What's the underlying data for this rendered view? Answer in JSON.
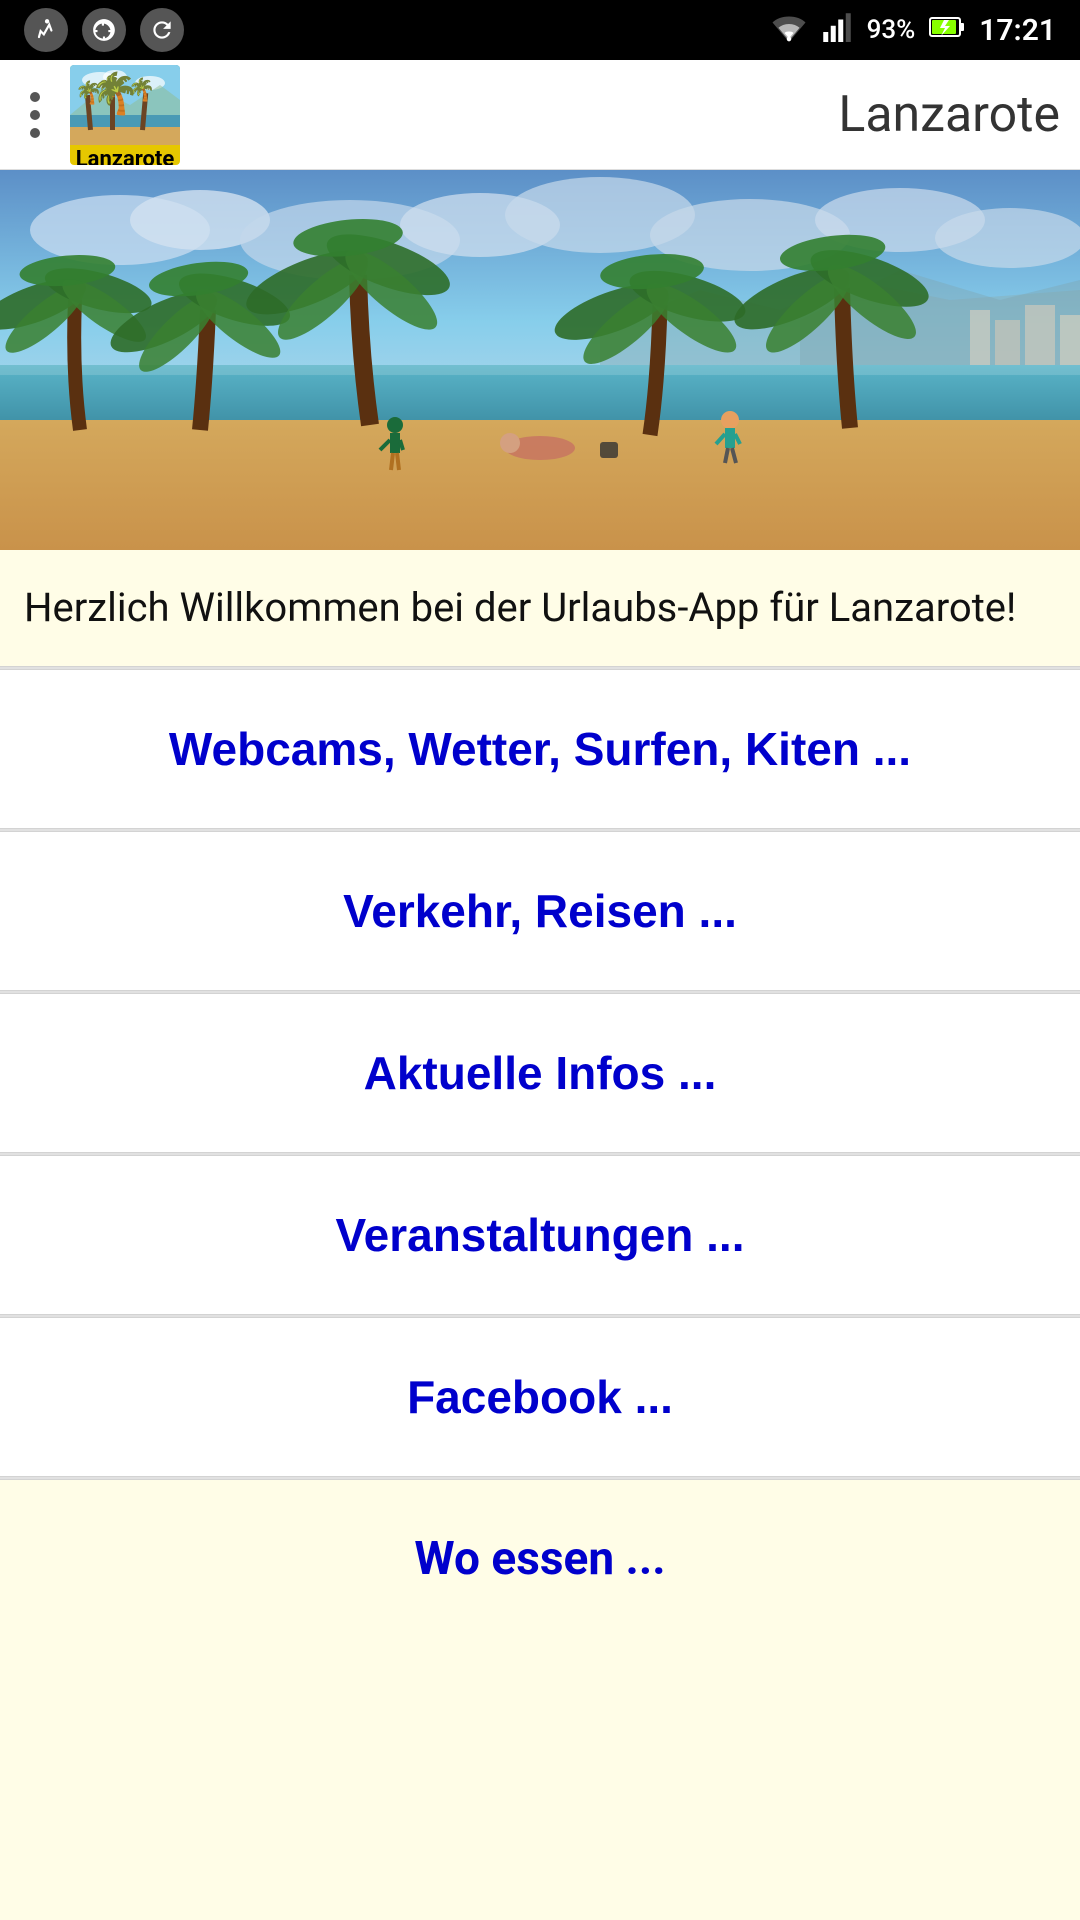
{
  "statusBar": {
    "battery": "93%",
    "time": "17:21",
    "icons": [
      "running-icon",
      "accessibility-icon",
      "refresh-icon"
    ]
  },
  "appBar": {
    "menuLabel": "menu",
    "iconLabel": "Lanzarote",
    "title": "Lanzarote"
  },
  "hero": {
    "altText": "Lanzarote beach with palm trees"
  },
  "welcome": {
    "text": "Herzlich Willkommen bei der Urlaubs-App für Lanzarote!"
  },
  "menuItems": [
    {
      "id": "webcams",
      "label": "Webcams, Wetter, Surfen, Kiten ..."
    },
    {
      "id": "verkehr",
      "label": "Verkehr, Reisen ..."
    },
    {
      "id": "infos",
      "label": "Aktuelle Infos ..."
    },
    {
      "id": "events",
      "label": "Veranstaltungen ..."
    },
    {
      "id": "facebook",
      "label": "Facebook ..."
    }
  ],
  "bottomItem": {
    "label": "Wo essen ..."
  }
}
